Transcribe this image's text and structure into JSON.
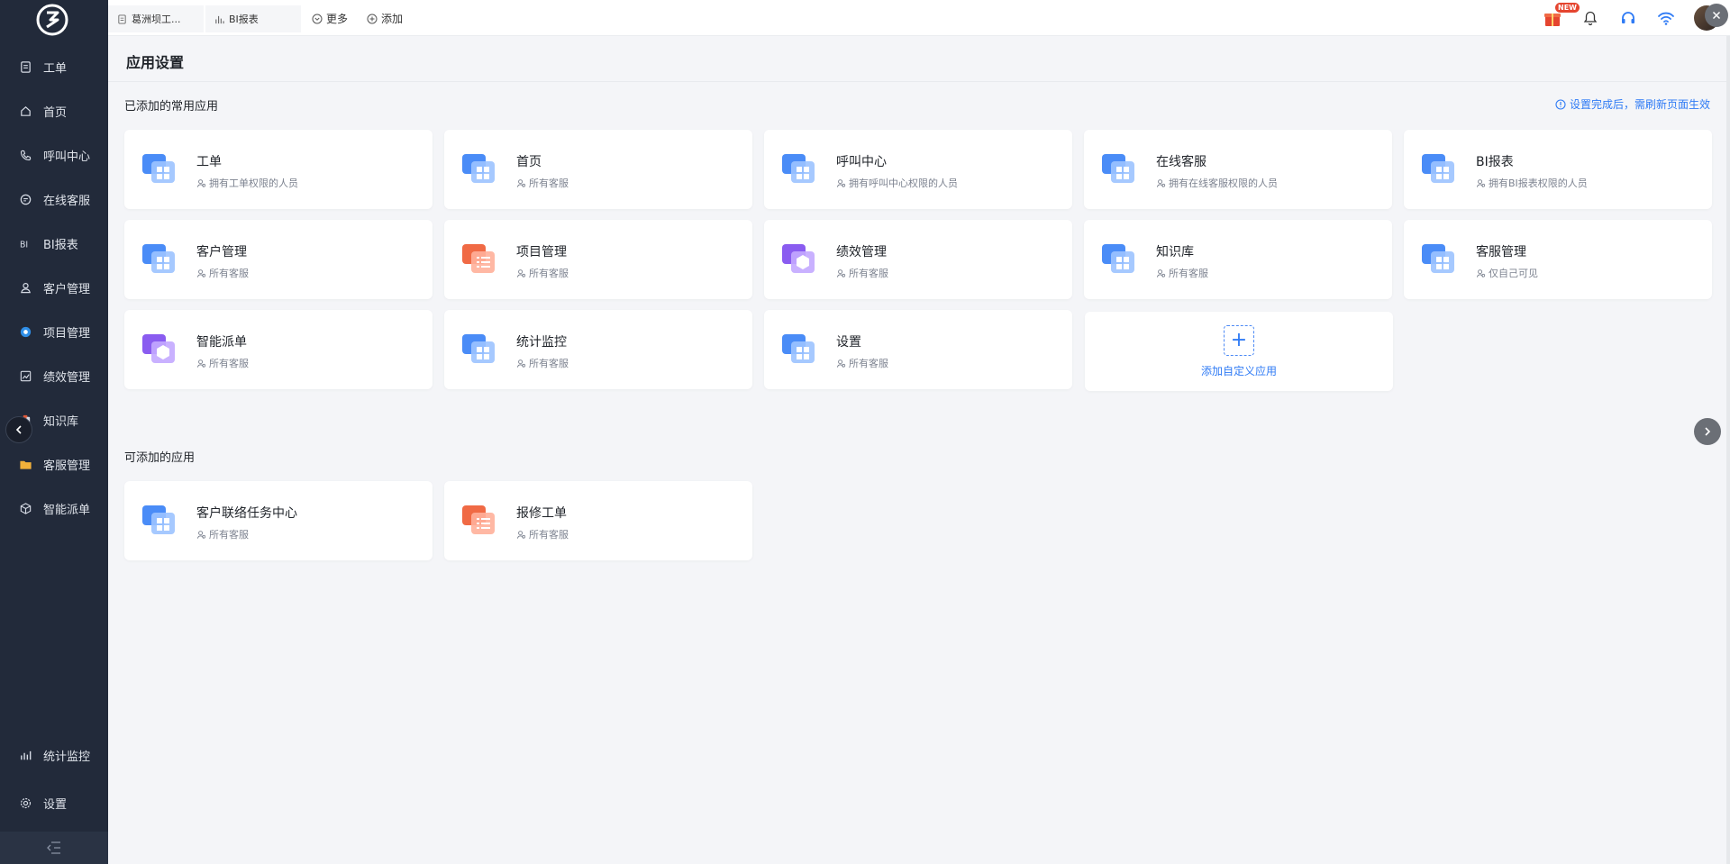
{
  "sidebar": {
    "items": [
      {
        "label": "工单",
        "icon": "doc-icon"
      },
      {
        "label": "首页",
        "icon": "home-icon"
      },
      {
        "label": "呼叫中心",
        "icon": "phone-icon"
      },
      {
        "label": "在线客服",
        "icon": "chat-icon"
      },
      {
        "label": "BI报表",
        "icon": "bi-icon"
      },
      {
        "label": "客户管理",
        "icon": "user-icon"
      },
      {
        "label": "项目管理",
        "icon": "project-icon"
      },
      {
        "label": "绩效管理",
        "icon": "chart-icon"
      },
      {
        "label": "知识库",
        "icon": "book-icon"
      },
      {
        "label": "客服管理",
        "icon": "folder-icon"
      },
      {
        "label": "智能派单",
        "icon": "cube-icon"
      }
    ],
    "bottom_items": [
      {
        "label": "统计监控",
        "icon": "bar-chart-icon"
      },
      {
        "label": "设置",
        "icon": "gear-icon"
      }
    ]
  },
  "topbar": {
    "tabs": [
      {
        "label": "葛洲坝工..."
      },
      {
        "label": "BI报表"
      }
    ],
    "more_label": "更多",
    "add_label": "添加",
    "new_badge": "NEW"
  },
  "main": {
    "title": "应用设置",
    "added_section_title": "已添加的常用应用",
    "notice": "设置完成后，需刷新页面生效",
    "added_apps": [
      {
        "name": "工单",
        "perm": "拥有工单权限的人员",
        "icon": "blue"
      },
      {
        "name": "首页",
        "perm": "所有客服",
        "icon": "blue"
      },
      {
        "name": "呼叫中心",
        "perm": "拥有呼叫中心权限的人员",
        "icon": "blue"
      },
      {
        "name": "在线客服",
        "perm": "拥有在线客服权限的人员",
        "icon": "blue"
      },
      {
        "name": "BI报表",
        "perm": "拥有BI报表权限的人员",
        "icon": "blue"
      },
      {
        "name": "客户管理",
        "perm": "所有客服",
        "icon": "blue"
      },
      {
        "name": "项目管理",
        "perm": "所有客服",
        "icon": "orange"
      },
      {
        "name": "绩效管理",
        "perm": "所有客服",
        "icon": "purple"
      },
      {
        "name": "知识库",
        "perm": "所有客服",
        "icon": "blue"
      },
      {
        "name": "客服管理",
        "perm": "仅自己可见",
        "icon": "blue"
      },
      {
        "name": "智能派单",
        "perm": "所有客服",
        "icon": "purple"
      },
      {
        "name": "统计监控",
        "perm": "所有客服",
        "icon": "blue"
      },
      {
        "name": "设置",
        "perm": "所有客服",
        "icon": "blue"
      }
    ],
    "add_custom_label": "添加自定义应用",
    "available_section_title": "可添加的应用",
    "available_apps": [
      {
        "name": "客户联络任务中心",
        "perm": "所有客服",
        "icon": "blue"
      },
      {
        "name": "报修工单",
        "perm": "所有客服",
        "icon": "orange"
      }
    ]
  },
  "colors": {
    "sidebar_bg": "#222a3a",
    "accent": "#2f7bf5",
    "page_bg": "#f4f5f8"
  }
}
